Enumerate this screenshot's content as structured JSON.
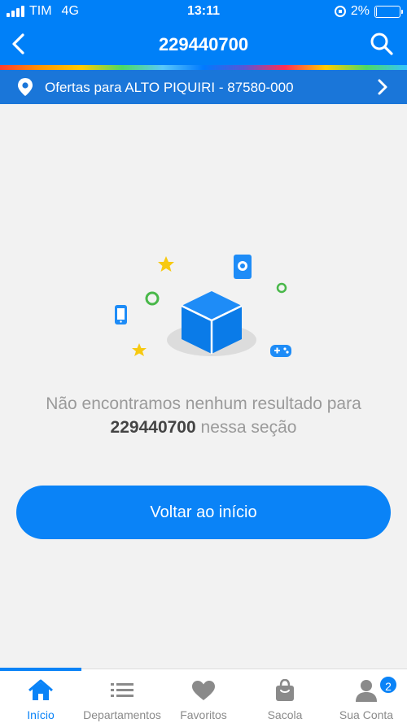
{
  "status_bar": {
    "carrier": "TIM",
    "network": "4G",
    "time": "13:11",
    "battery_percent": "2%",
    "battery_level": 0.02
  },
  "header": {
    "title": "229440700"
  },
  "location": {
    "text": "Ofertas para ALTO PIQUIRI - 87580-000"
  },
  "empty_state": {
    "message_prefix": "Não encontramos nenhum resultado para",
    "query": "229440700",
    "message_suffix": "nessa seção"
  },
  "home_button": {
    "label": "Voltar ao início"
  },
  "tabs": [
    {
      "label": "Início",
      "icon": "home-icon",
      "active": true
    },
    {
      "label": "Departamentos",
      "icon": "list-icon",
      "active": false
    },
    {
      "label": "Favoritos",
      "icon": "heart-icon",
      "active": false
    },
    {
      "label": "Sacola",
      "icon": "bag-icon",
      "active": false
    },
    {
      "label": "Sua Conta",
      "icon": "user-icon",
      "active": false,
      "badge": "2"
    }
  ],
  "colors": {
    "primary": "#0080f8",
    "location_bar": "#1a76d9",
    "button": "#0a83f7",
    "background": "#f2f2f2"
  }
}
